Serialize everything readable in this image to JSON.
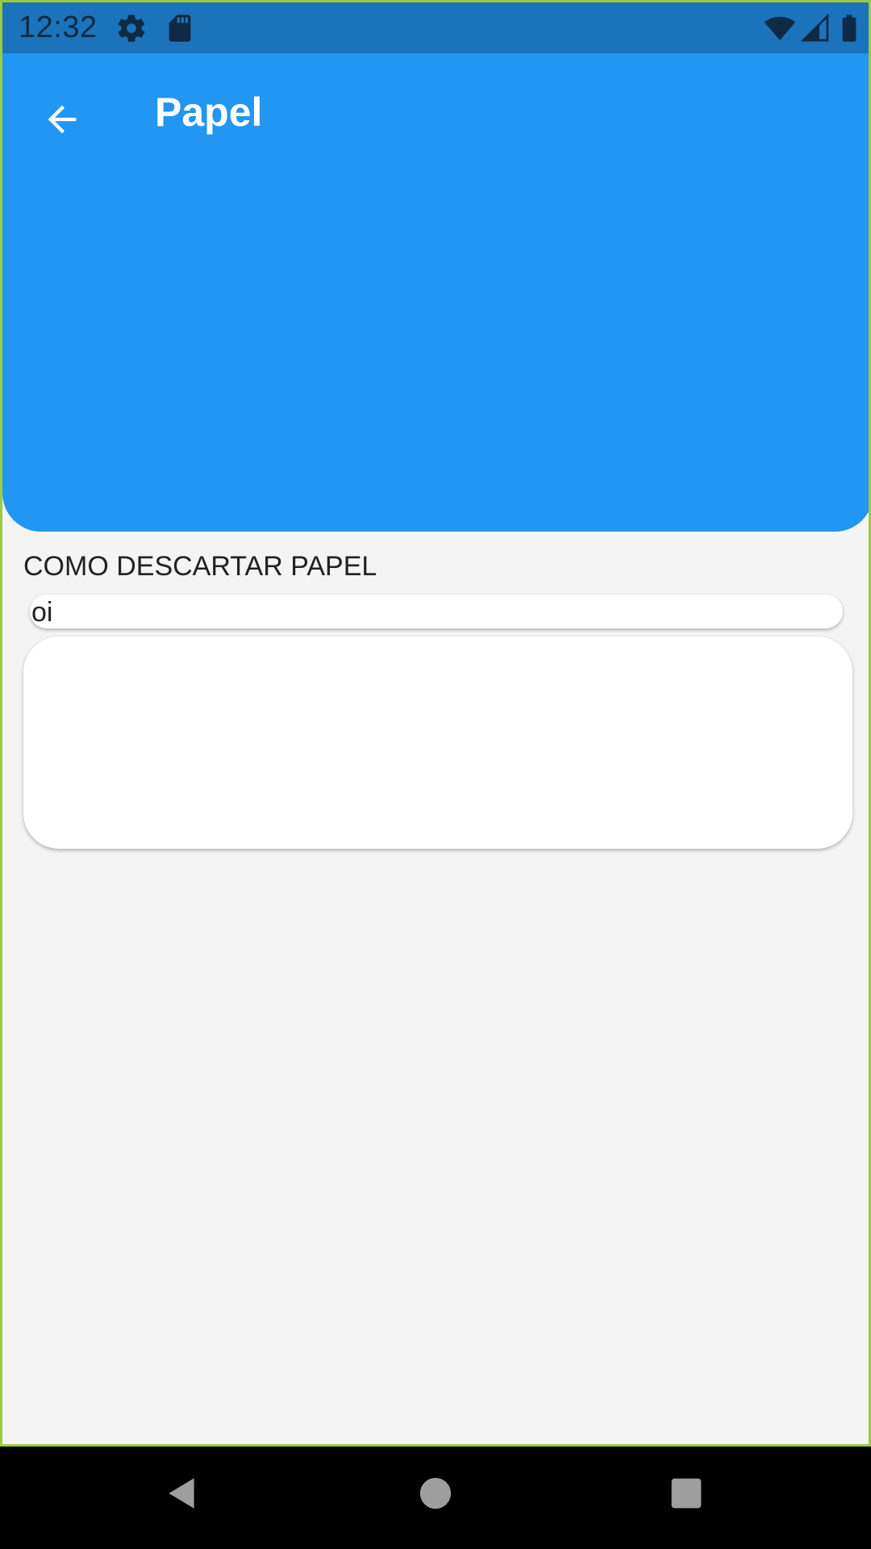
{
  "status_bar": {
    "time": "12:32",
    "icons": [
      "settings-icon",
      "sd-card-icon",
      "wifi-icon",
      "cell-signal-icon",
      "battery-icon"
    ]
  },
  "header": {
    "title": "Papel",
    "back_icon": "arrow-back-icon",
    "color": "#2196f3"
  },
  "content": {
    "section_title": "COMO DESCARTAR PAPEL",
    "short_text": "oi",
    "long_text": ""
  },
  "nav_bar": {
    "icons": [
      "back-triangle-icon",
      "home-circle-icon",
      "recents-square-icon"
    ]
  },
  "colors": {
    "status_bar": "#1b73bb",
    "background": "#f4f4f4",
    "frame_border": "#9ccc3c"
  }
}
